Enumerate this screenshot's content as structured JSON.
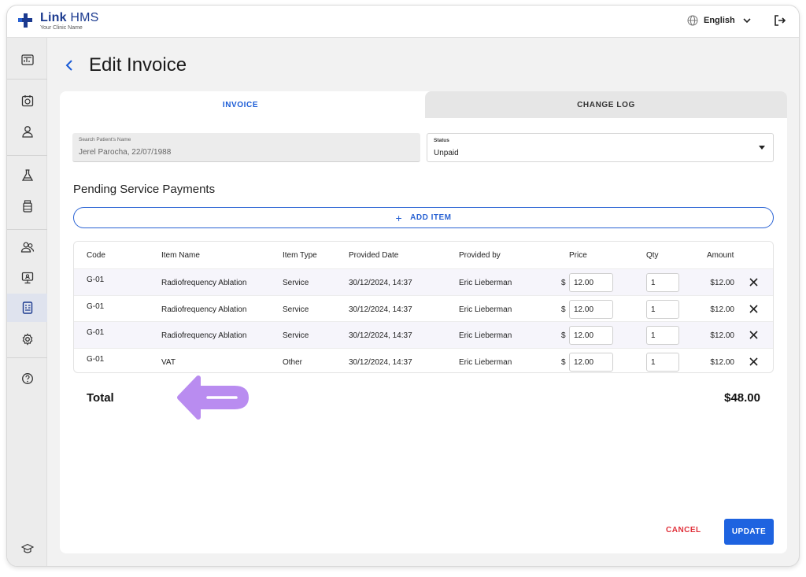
{
  "app": {
    "name_bold": "Link",
    "name_rest": "HMS",
    "subtitle": "Your Clinic Name"
  },
  "topbar": {
    "language": "English"
  },
  "sidebar": {
    "items": [
      {
        "icon": "dashboard-icon"
      },
      {
        "icon": "calendar-icon"
      },
      {
        "icon": "user-icon"
      },
      {
        "icon": "lab-flask-icon"
      },
      {
        "icon": "medicine-bottle-icon"
      },
      {
        "icon": "staff-icon"
      },
      {
        "icon": "monitor-icon"
      },
      {
        "icon": "invoice-icon",
        "active": true
      },
      {
        "icon": "gear-icon"
      },
      {
        "icon": "help-icon"
      },
      {
        "icon": "graduation-cap-icon"
      }
    ]
  },
  "page": {
    "title": "Edit Invoice"
  },
  "tabs": [
    {
      "label": "INVOICE",
      "active": true
    },
    {
      "label": "CHANGE LOG",
      "active": false
    }
  ],
  "form": {
    "patient": {
      "label": "Search Patient's Name",
      "value": "Jerel Parocha, 22/07/1988"
    },
    "status": {
      "label": "Status",
      "value": "Unpaid"
    }
  },
  "section": {
    "title": "Pending Service Payments",
    "add_item_label": "ADD ITEM"
  },
  "table": {
    "headers": {
      "code": "Code",
      "item_name": "Item Name",
      "item_type": "Item Type",
      "provided_date": "Provided Date",
      "provided_by": "Provided by",
      "price": "Price",
      "qty": "Qty",
      "amount": "Amount"
    },
    "currency": "$",
    "rows": [
      {
        "code": "G-01",
        "item_name": "Radiofrequency Ablation",
        "item_type": "Service",
        "provided_date": "30/12/2024, 14:37",
        "provided_by": "Eric Lieberman",
        "price": "12.00",
        "qty": "1",
        "amount": "$12.00"
      },
      {
        "code": "G-01",
        "item_name": "Radiofrequency Ablation",
        "item_type": "Service",
        "provided_date": "30/12/2024, 14:37",
        "provided_by": "Eric Lieberman",
        "price": "12.00",
        "qty": "1",
        "amount": "$12.00"
      },
      {
        "code": "G-01",
        "item_name": "Radiofrequency Ablation",
        "item_type": "Service",
        "provided_date": "30/12/2024, 14:37",
        "provided_by": "Eric Lieberman",
        "price": "12.00",
        "qty": "1",
        "amount": "$12.00"
      },
      {
        "code": "G-01",
        "item_name": "VAT",
        "item_type": "Other",
        "provided_date": "30/12/2024, 14:37",
        "provided_by": "Eric Lieberman",
        "price": "12.00",
        "qty": "1",
        "amount": "$12.00"
      }
    ]
  },
  "total": {
    "label": "Total",
    "value": "$48.00"
  },
  "actions": {
    "cancel": "CANCEL",
    "update": "UPDATE"
  },
  "colors": {
    "primary": "#1e63e0",
    "danger": "#e0303a",
    "annotation_arrow": "#b98cf0"
  }
}
